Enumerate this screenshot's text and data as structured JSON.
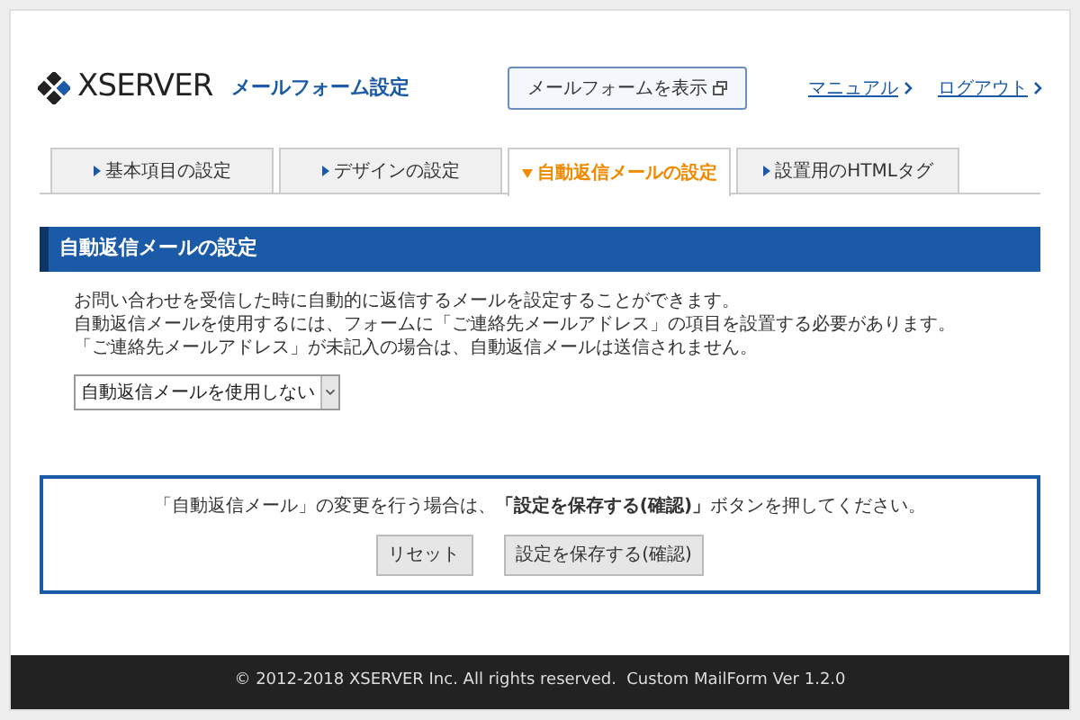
{
  "header": {
    "logo": "XSERVER",
    "app_title": "メールフォーム設定",
    "view_button": "メールフォームを表示",
    "links": [
      "マニュアル",
      "ログアウト"
    ]
  },
  "tabs": [
    {
      "label": "基本項目の設定",
      "selected": false
    },
    {
      "label": "デザインの設定",
      "selected": false
    },
    {
      "label": "自動返信メールの設定",
      "selected": true
    },
    {
      "label": "設置用のHTMLタグ",
      "selected": false
    }
  ],
  "section": {
    "title": "自動返信メールの設定",
    "description": [
      "お問い合わせを受信した時に自動的に返信するメールを設定することができます。",
      "自動返信メールを使用するには、フォームに「ご連絡先メールアドレス」の項目を設置する必要があります。",
      "「ご連絡先メールアドレス」が未記入の場合は、自動返信メールは送信されません。"
    ],
    "select_value": "自動返信メールを使用しない"
  },
  "notice": {
    "text": "「自動返信メール」の変更を行う場合は、**「設定を保存する(確認)」**ボタンを押してください。",
    "buttons": [
      "リセット",
      "設定を保存する(確認)"
    ]
  },
  "footer": "© 2012-2018 XSERVER Inc. All rights reserved.  Custom MailForm Ver 1.2.0"
}
